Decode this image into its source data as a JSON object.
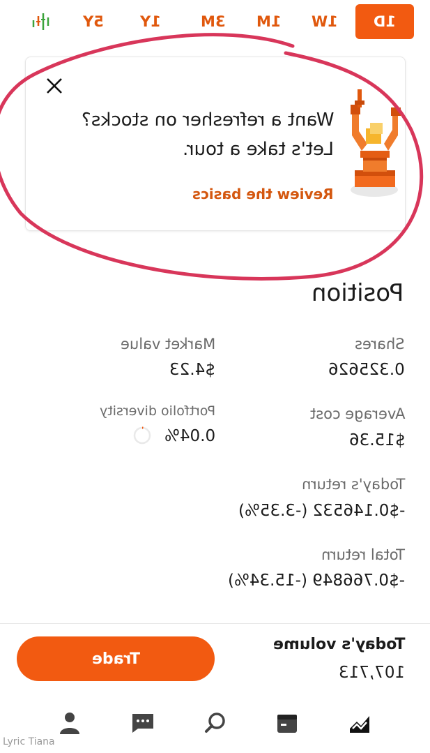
{
  "range_tabs": [
    {
      "label": "1D",
      "active": true
    },
    {
      "label": "1W",
      "active": false
    },
    {
      "label": "1M",
      "active": false
    },
    {
      "label": "3M",
      "active": false
    },
    {
      "label": "1Y",
      "active": false
    },
    {
      "label": "5Y",
      "active": false
    }
  ],
  "chart_toggle_icon": "candlestick-icon",
  "card": {
    "line1": "Want a refresher on stocks?",
    "line2": "Let's take a tour.",
    "link": "Review the basics",
    "close_icon": "close-icon",
    "illustration": "robot-arm-illustration"
  },
  "position": {
    "title": "Position",
    "shares_label": "Shares",
    "shares_value": "0.325626",
    "market_value_label": "Market value",
    "market_value_value": "$4.23",
    "avg_cost_label": "Average cost",
    "avg_cost_value": "$15.36",
    "diversity_label": "Portfolio diversity",
    "diversity_value": "0.04%",
    "diversity_fraction": 0.0004,
    "todays_return_label": "Today's return",
    "todays_return_value": "-$0.146532 (-3.35%)",
    "total_return_label": "Total return",
    "total_return_value": "-$0.766849 (-15.34%)"
  },
  "footer": {
    "trade_label": "Trade",
    "volume_label": "Today's volume",
    "volume_value": "107,713"
  },
  "bottom_nav": [
    "investing-icon",
    "browse-icon",
    "search-icon",
    "messages-icon",
    "account-icon"
  ],
  "watermark": "Lyric Tiana",
  "colors": {
    "accent": "#f25a11",
    "annotation_circle": "#d8365a"
  }
}
